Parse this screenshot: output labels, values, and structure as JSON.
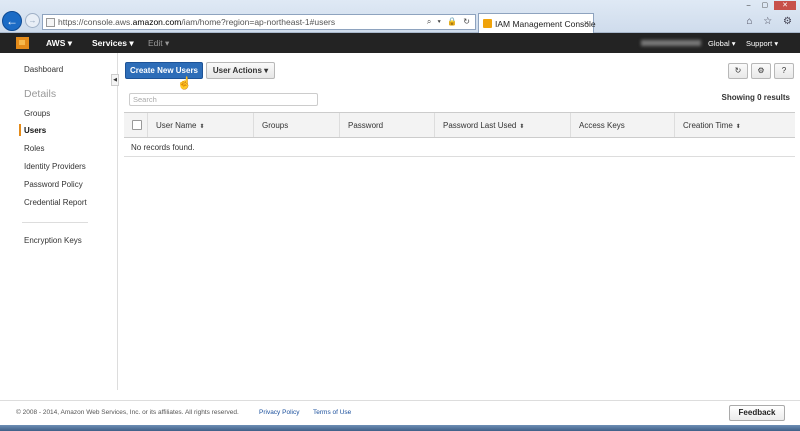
{
  "browser": {
    "back_icon": "arrow-left-icon",
    "forward_icon": "arrow-right-icon",
    "url_prefix": "https://console.aws.",
    "url_domain": "amazon.com",
    "url_path": "/iam/home?region=ap-northeast-1#users",
    "address_icons": "⌕ ▾ 🔒 ↻",
    "tab_title": "IAM Management Console",
    "tab_close": "×",
    "window_controls": [
      "–",
      "▢",
      "✕"
    ],
    "toolbar_icons": "⌂ ☆ ⚙"
  },
  "aws_nav": {
    "aws_label": "AWS ▾",
    "services_label": "Services ▾",
    "edit_label": "Edit ▾",
    "region_label": "Global ▾",
    "support_label": "Support ▾"
  },
  "sidebar": {
    "dashboard": "Dashboard",
    "details_heading": "Details",
    "items": [
      "Groups",
      "Users",
      "Roles",
      "Identity Providers",
      "Password Policy",
      "Credential Report"
    ],
    "encryption_keys": "Encryption Keys",
    "collapse_icon": "◀"
  },
  "toolbar": {
    "create_label": "Create New Users",
    "actions_label": "User Actions ▾",
    "refresh_icon": "↻",
    "settings_icon": "⚙",
    "help_icon": "?"
  },
  "search": {
    "placeholder": "Search"
  },
  "results": {
    "count_text": "Showing 0 results"
  },
  "table": {
    "columns": [
      {
        "label": "User Name",
        "sort": "⬍"
      },
      {
        "label": "Groups",
        "sort": ""
      },
      {
        "label": "Password",
        "sort": ""
      },
      {
        "label": "Password Last Used",
        "sort": "⬍"
      },
      {
        "label": "Access Keys",
        "sort": ""
      },
      {
        "label": "Creation Time",
        "sort": "⬍"
      }
    ],
    "empty_text": "No records found."
  },
  "footer": {
    "copyright": "© 2008 - 2014, Amazon Web Services, Inc. or its affiliates. All rights reserved.",
    "privacy": "Privacy Policy",
    "terms": "Terms of Use",
    "feedback": "Feedback"
  }
}
